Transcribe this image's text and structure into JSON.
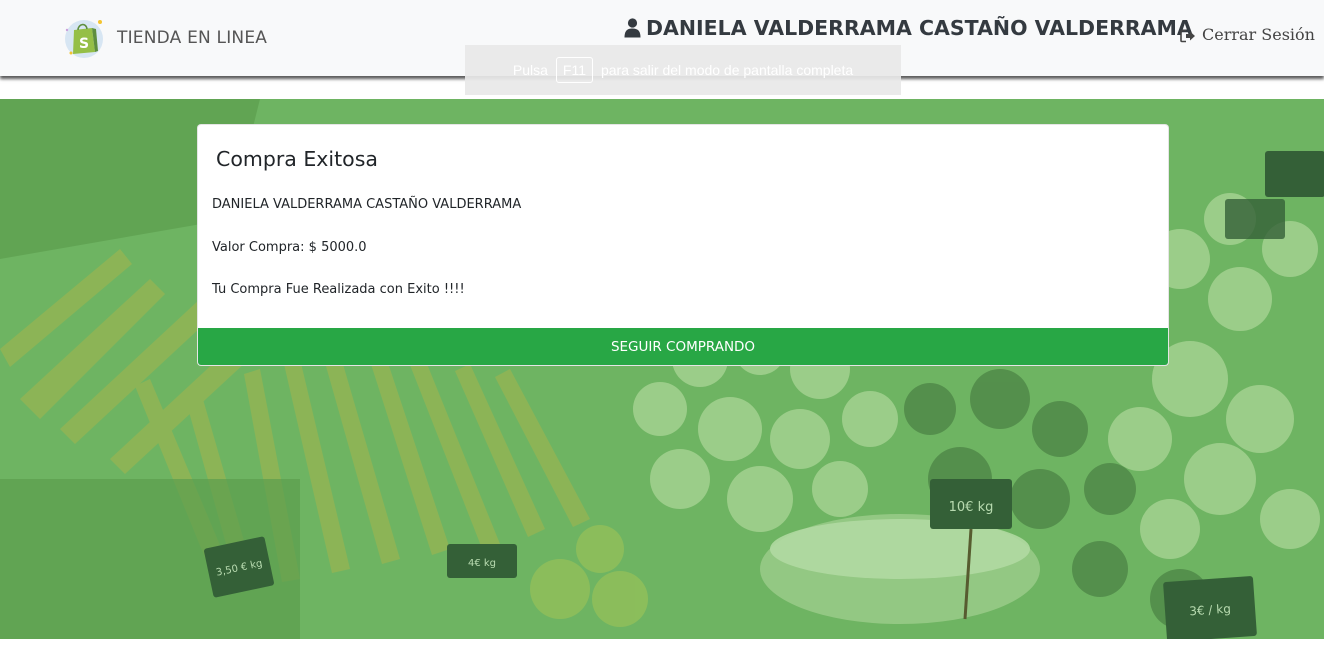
{
  "navbar": {
    "brand_text": "TIENDA EN LINEA",
    "brand_icon": "shopify-bag-icon",
    "user_icon": "user-icon",
    "user_name": "DANIELA VALDERRAMA CASTAÑO VALDERRAMA",
    "logout_icon": "sign-out-icon",
    "logout_label": "Cerrar Sesión"
  },
  "fullscreen_notice": {
    "prefix": "Pulsa",
    "key": "F11",
    "suffix": "para salir del modo de pantalla completa"
  },
  "card": {
    "title": "Compra Exitosa",
    "customer_name": "DANIELA VALDERRAMA CASTAÑO VALDERRAMA",
    "purchase_value": "Valor Compra: $ 5000.0",
    "message": "Tu Compra Fue Realizada con Exito !!!!",
    "button_label": "SEGUIR COMPRANDO"
  },
  "background": {
    "price_tags": [
      "3,50 € kg",
      "4€ kg",
      "10€ kg",
      "3€ / kg"
    ]
  },
  "colors": {
    "navbar_bg": "#f8f9fa",
    "success_green": "#28a745",
    "overlay_green": "#74b466"
  }
}
